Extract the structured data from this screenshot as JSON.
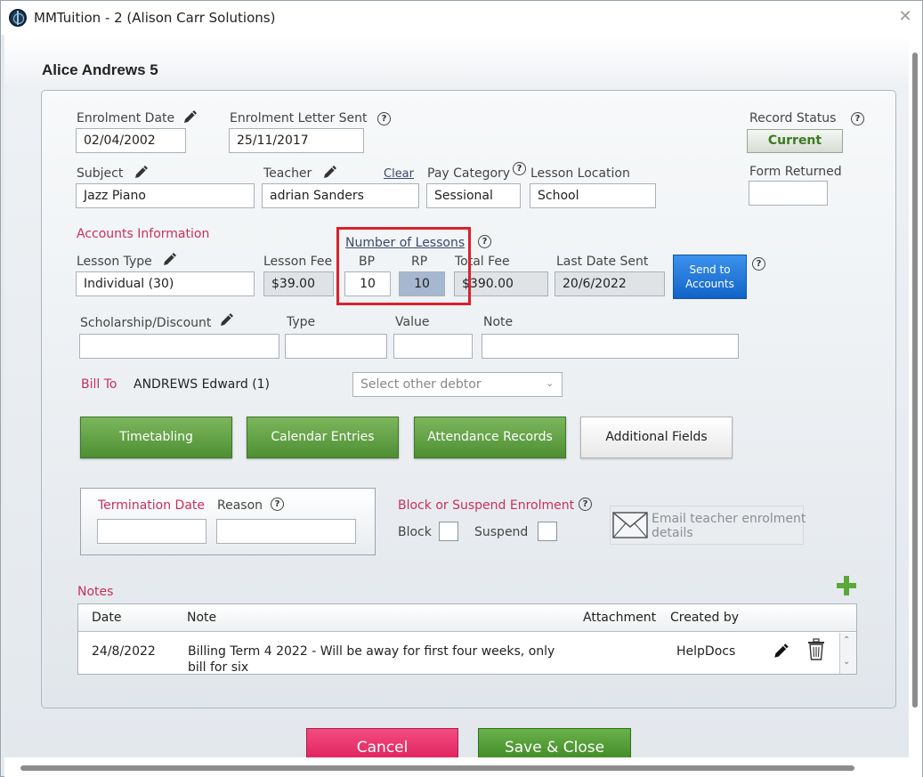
{
  "window": {
    "title": "MMTuition - 2 (Alison Carr Solutions)"
  },
  "student": {
    "name": "Alice Andrews 5"
  },
  "enrolment": {
    "enrolment_date_label": "Enrolment Date",
    "enrolment_date": "02/04/2002",
    "letter_sent_label": "Enrolment Letter Sent",
    "letter_sent": "25/11/2017",
    "record_status_label": "Record Status",
    "record_status": "Current",
    "subject_label": "Subject",
    "subject": "Jazz Piano",
    "teacher_label": "Teacher",
    "teacher_clear": "Clear",
    "teacher": "adrian Sanders",
    "pay_category_label": "Pay Category",
    "pay_category": "Sessional",
    "lesson_location_label": "Lesson Location",
    "lesson_location": "School",
    "form_returned_label": "Form Returned",
    "form_returned": ""
  },
  "accounts": {
    "section_label": "Accounts Information",
    "lesson_type_label": "Lesson Type",
    "lesson_type": "Individual (30)",
    "lesson_fee_label": "Lesson Fee",
    "lesson_fee": "$39.00",
    "number_of_lessons_label": "Number of Lessons",
    "bp_label": "BP",
    "bp": "10",
    "rp_label": "RP",
    "rp": "10",
    "total_fee_label": "Total Fee",
    "total_fee": "$390.00",
    "last_date_sent_label": "Last Date Sent",
    "last_date_sent": "20/6/2022",
    "send_button": "Send to Accounts"
  },
  "scholarship": {
    "label": "Scholarship/Discount",
    "type_label": "Type",
    "value_label": "Value",
    "note_label": "Note"
  },
  "bill_to": {
    "label": "Bill To",
    "value": "ANDREWS Edward (1)",
    "select_placeholder": "Select other debtor"
  },
  "actions": {
    "timetabling": "Timetabling",
    "calendar_entries": "Calendar Entries",
    "attendance_records": "Attendance Records",
    "additional_fields": "Additional Fields"
  },
  "termination": {
    "date_label": "Termination Date",
    "reason_label": "Reason"
  },
  "block": {
    "section_label": "Block or Suspend Enrolment",
    "block_label": "Block",
    "suspend_label": "Suspend",
    "email_text": "Email teacher enrolment details"
  },
  "notes": {
    "section_label": "Notes",
    "columns": {
      "date": "Date",
      "note": "Note",
      "attachment": "Attachment",
      "created_by": "Created by"
    },
    "rows": [
      {
        "date": "24/8/2022",
        "note": "Billing Term 4 2022 - Will be away for first four weeks, only",
        "note_line2": "bill for six",
        "attachment": "",
        "created_by": "HelpDocs"
      }
    ]
  },
  "footer": {
    "cancel": "Cancel",
    "save_close": "Save & Close"
  },
  "colors": {
    "accent_red": "#c8305a",
    "green": "#4f8f33",
    "blue": "#1164c7",
    "highlight": "#d9222b"
  }
}
